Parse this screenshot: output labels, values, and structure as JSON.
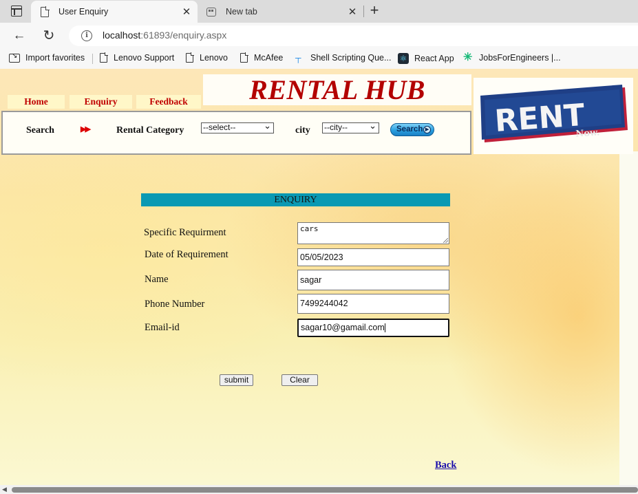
{
  "browser": {
    "tabs": [
      {
        "title": "User Enquiry",
        "close": "✕",
        "icon": "page-icon"
      },
      {
        "title": "New tab",
        "close": "✕",
        "icon": "new-tab-page-icon"
      }
    ],
    "new_tab": "+",
    "nav": {
      "back": "←",
      "reload": "↻"
    },
    "address": {
      "host": "localhost",
      "rest": ":61893/enquiry.aspx"
    },
    "favorites": [
      {
        "label": "Import favorites",
        "icon": "import-icon"
      },
      {
        "label": "Lenovo Support",
        "icon": "page-icon"
      },
      {
        "label": "Lenovo",
        "icon": "page-icon"
      },
      {
        "label": "McAfee",
        "icon": "page-icon"
      },
      {
        "label": "Shell Scripting Que...",
        "icon": "shell-icon"
      },
      {
        "label": "React App",
        "icon": "react-icon"
      },
      {
        "label": "JobsForEngineers |...",
        "icon": "jobs-icon"
      }
    ]
  },
  "site": {
    "nav": [
      "Home",
      "Enquiry",
      "Feedback"
    ],
    "banner_title": "RENTAL HUB",
    "logo": {
      "text": "RENT",
      "subtext": "Now."
    },
    "search": {
      "label": "Search",
      "category_label": "Rental Category",
      "category_value": "--select--",
      "city_label": "city",
      "city_value": "--city--",
      "button_label": "Search"
    }
  },
  "form": {
    "title": "ENQUIRY",
    "fields": [
      {
        "label": "Specific Requirment",
        "value": "cars"
      },
      {
        "label": "Date of Requirement",
        "value": "05/05/2023"
      },
      {
        "label": "Name",
        "value": "sagar"
      },
      {
        "label": "Phone Number",
        "value": "7499244042"
      },
      {
        "label": "Email-id",
        "value": "sagar10@gamail.com"
      }
    ],
    "submit": "submit",
    "clear": "Clear"
  },
  "back_link": "Back",
  "colors": {
    "nav_text": "#c00000",
    "banner_text": "#b30000",
    "enquiry_bar": "#0a99b3",
    "link": "#1a0dab"
  }
}
